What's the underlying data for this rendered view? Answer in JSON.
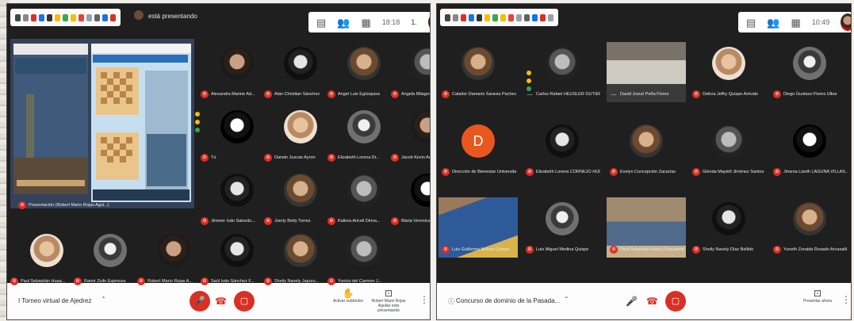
{
  "left": {
    "presenting_text": "está presentando",
    "clock": "18:18",
    "meeting_name": "I Torneo virtual de Ajedrez",
    "screen_share_label": "Presentación (Robert Mario Rojas Agui...)",
    "participants": [
      "Alexandra Marine Ad...",
      "Alan Christian Sánchez",
      "Angel Luis Egúsquiza",
      "Angela Milagros Díaz",
      "Tú",
      "Darwin Juscao Ayron",
      "Elizabeth Lorena Di...",
      "Jacob Kevin Antúnez",
      "Jimmer Iván Salcedo...",
      "Joerly Betty Torres",
      "Kaliora Ariceli Diriva...",
      "Maria Veronica Mo...",
      "Paul Sebastián Huaq...",
      "Ramir Zoilo Espinoza",
      "Robert Mario Rojas A...",
      "Saúl Iván Sánchez F...",
      "Sheily Navely Japuru...",
      "Yuricio del Carmen J..."
    ],
    "captions_label": "Activar subtítulos",
    "presenting_label": "Robert Mario Rojas Aguilar está presentando"
  },
  "right": {
    "clock": "10:49",
    "meeting_name": "Concurso de dominio de la Pasada...",
    "participants": [
      "Calador Damaris Saravia Pacheco",
      "Carlos Rafael HEUSLER GUTIERR...",
      "David Josué Peña Flores",
      "Delicia Jeffry Quispe Arévalo",
      "Diego Gustavo Flores Ulloa",
      "Dirección de Bienestar Universitario",
      "Elizabeth Lorena CORNEJO HUCA...",
      "Evelyn Concepción Zacarías",
      "Glenda Maytell Jiménez Santos",
      "Jimena Lizeth LAGUNA VILLAS...",
      "Luis Guillermo Nelson Quispe",
      "Luis Miguel Medina Quispe",
      "Paul Sebastián Huaq Churupampa",
      "Sheily Navely Díaz Bellido",
      "Yuneth Zoraida Rosado Arcasatli"
    ],
    "presenting_label": "Presentar ahora"
  },
  "colors": {
    "meet_red": "#d93025",
    "tile_bg": "#1f1f1f",
    "toolbar_bg": "#ffffff"
  },
  "icons": [
    "doc-icon",
    "people-icon",
    "chat-icon",
    "mic-icon",
    "end-call-icon",
    "camera-off-icon",
    "hand-icon",
    "present-icon",
    "more-icon"
  ]
}
